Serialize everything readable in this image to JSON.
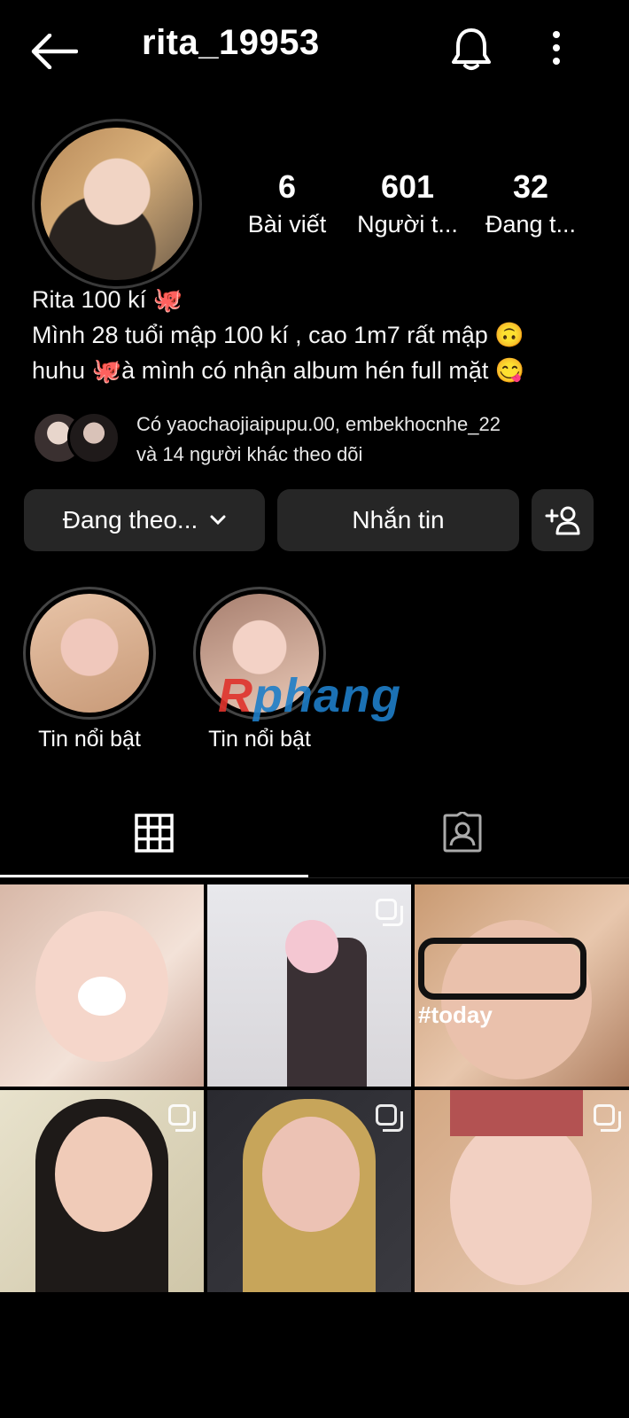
{
  "header": {
    "username": "rita_19953"
  },
  "stats": [
    {
      "value": "6",
      "label": "Bài viết"
    },
    {
      "value": "601",
      "label": "Người t..."
    },
    {
      "value": "32",
      "label": "Đang t..."
    }
  ],
  "bio": {
    "name": "Rita 100 kí 🐙",
    "line1": "Mình 28 tuổi mập 100 kí , cao 1m7 rất mập 🙃",
    "line2": "huhu 🐙à mình có nhận album hén full mặt 😋"
  },
  "followed_by": {
    "line1": "Có yaochaojiaipupu.00, embekhocnhe_22",
    "line2": "và 14 người khác theo dõi"
  },
  "actions": {
    "following_label": "Đang theo...",
    "message_label": "Nhắn tin"
  },
  "highlights": [
    {
      "label": "Tin nổi bật"
    },
    {
      "label": "Tin nổi bật"
    }
  ],
  "watermark": {
    "prefix": "R",
    "text": "phang"
  },
  "grid": {
    "posts": [
      {
        "has_multi": false
      },
      {
        "has_multi": true
      },
      {
        "has_multi": false,
        "overlay_text": "#today"
      },
      {
        "has_multi": true
      },
      {
        "has_multi": true
      },
      {
        "has_multi": true
      }
    ]
  },
  "colors": {
    "background": "#000000",
    "button": "#262626",
    "text": "#f5f5f5",
    "watermark_blue": "#1e7ec8",
    "watermark_red": "#e0332c"
  },
  "icons": [
    "back-arrow-icon",
    "bell-icon",
    "more-vertical-icon",
    "chevron-down-icon",
    "add-person-icon",
    "grid-icon",
    "tagged-icon",
    "multi-post-icon"
  ]
}
